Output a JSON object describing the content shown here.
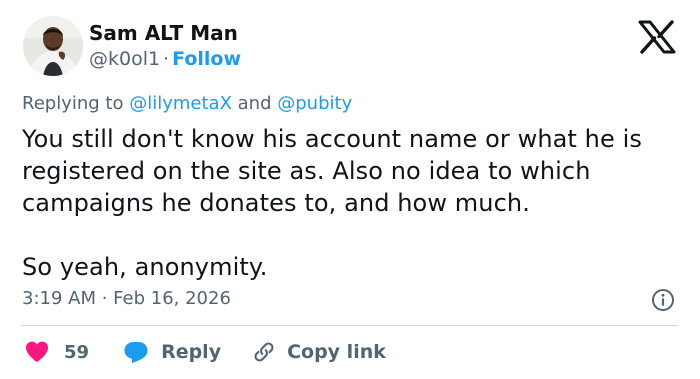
{
  "author": {
    "display_name": "Sam ALT Man",
    "handle": "@k0ol1",
    "separator": "·",
    "follow_label": "Follow",
    "avatar_icon": "avatar-photo"
  },
  "platform": {
    "logo_icon": "x-logo-icon"
  },
  "reply_context": {
    "prefix": "Replying to",
    "mention_1": "@lilymetaX",
    "conjunction": "and",
    "mention_2": "@pubity"
  },
  "tweet": {
    "paragraph_1": "You still don't know his account name or what he is\nregistered on the site as. Also no idea to which\ncampaigns he donates to, and how much.",
    "paragraph_2": "So yeah, anonymity.",
    "timestamp": "3:19 AM · Feb 16, 2026"
  },
  "actions": {
    "like_count": "59",
    "reply_label": "Reply",
    "copy_label": "Copy link"
  },
  "colors": {
    "accent": "#1d9bf0",
    "like": "#f91880",
    "muted": "#536471",
    "text": "#0f1419",
    "divider": "#cfd9de"
  }
}
